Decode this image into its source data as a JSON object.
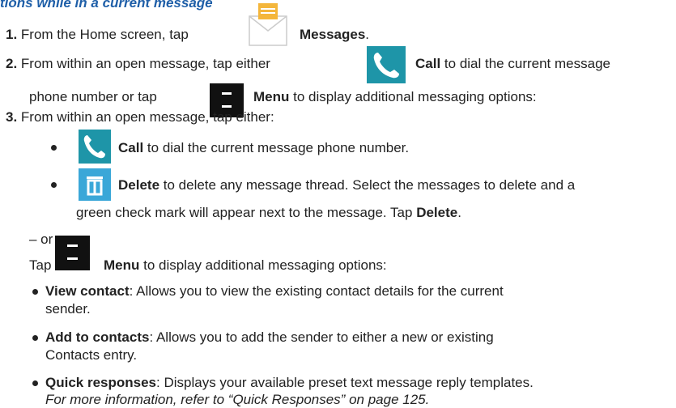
{
  "heading": "tions while in a current message",
  "steps": [
    {
      "num": "1.",
      "pre": "From the Home screen, tap",
      "label": "Messages",
      "post": "."
    },
    {
      "num": "2.",
      "pre": "From within an open message, tap either",
      "label": "Call",
      "post": "to dial the current message",
      "line2_pre": "phone number or tap",
      "line2_label": "Menu",
      "line2_post": "to display additional messaging options:"
    },
    {
      "num": "3.",
      "pre": "From within an open message, tap either:"
    }
  ],
  "bullets": [
    {
      "label": "Call",
      "text": "to dial the current message phone number."
    },
    {
      "label": "Delete",
      "text": "to delete any message thread. Select the messages to delete and a",
      "line2_pre": "green check mark will appear next to the message. Tap",
      "line2_label": "Delete",
      "line2_post": "."
    }
  ],
  "or_text": "– or",
  "tap_menu": {
    "pre": "Tap",
    "label": "Menu",
    "post": "to display additional messaging options:"
  },
  "sub_bullets": [
    {
      "label": "View contact",
      "text": ": Allows you to view the existing contact details for the current",
      "line2": "sender."
    },
    {
      "label": "Add to contacts",
      "text": ": Allows you to add the sender to either a new or existing",
      "line2": "Contacts entry."
    },
    {
      "label": "Quick responses",
      "text": ": Displays your available preset text message reply templates.",
      "line2": "For more information, refer to “Quick Responses” on page 125."
    }
  ],
  "icons": {
    "messages": "messages-envelope-icon",
    "call": "phone-call-icon",
    "menu": "menu-icon",
    "delete": "trash-icon"
  },
  "colors": {
    "heading": "#1f5fa8",
    "call_bg": "#1e95a8",
    "delete_bg": "#3aa7d8",
    "envelope": "#f4b63b"
  }
}
